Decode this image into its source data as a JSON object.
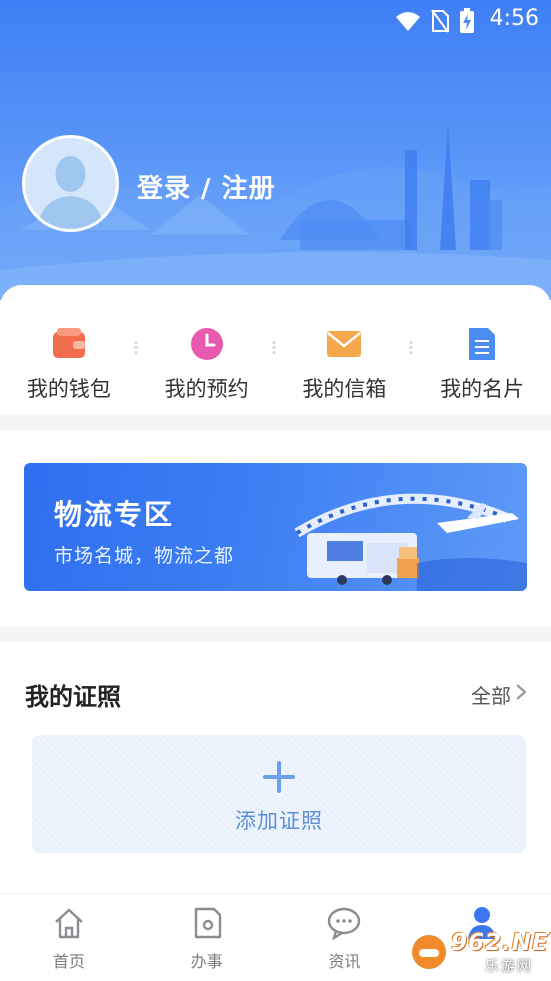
{
  "status_bar": {
    "time": "4:56"
  },
  "profile": {
    "login_label": "登录 / 注册"
  },
  "quick_actions": [
    {
      "label": "我的钱包",
      "icon": "wallet-icon",
      "color": "#f26d4e"
    },
    {
      "label": "我的预约",
      "icon": "clock-icon",
      "color": "#e85ab0"
    },
    {
      "label": "我的信箱",
      "icon": "mail-icon",
      "color": "#f5a94a"
    },
    {
      "label": "我的名片",
      "icon": "document-icon",
      "color": "#4a8cf0"
    }
  ],
  "banner": {
    "title": "物流专区",
    "subtitle": "市场名城，物流之都"
  },
  "certificates": {
    "title": "我的证照",
    "all_label": "全部",
    "add_label": "添加证照"
  },
  "bottom_nav": [
    {
      "label": "首页",
      "icon": "home-icon"
    },
    {
      "label": "办事",
      "icon": "tasks-icon"
    },
    {
      "label": "资讯",
      "icon": "chat-icon"
    },
    {
      "label": "",
      "icon": "profile-icon",
      "active": true
    }
  ],
  "watermark": {
    "logo": "962.NET",
    "site": "乐游网"
  },
  "colors": {
    "primary": "#3b78f0",
    "header_top": "#3f7ff6",
    "header_bottom": "#7db0fa"
  }
}
